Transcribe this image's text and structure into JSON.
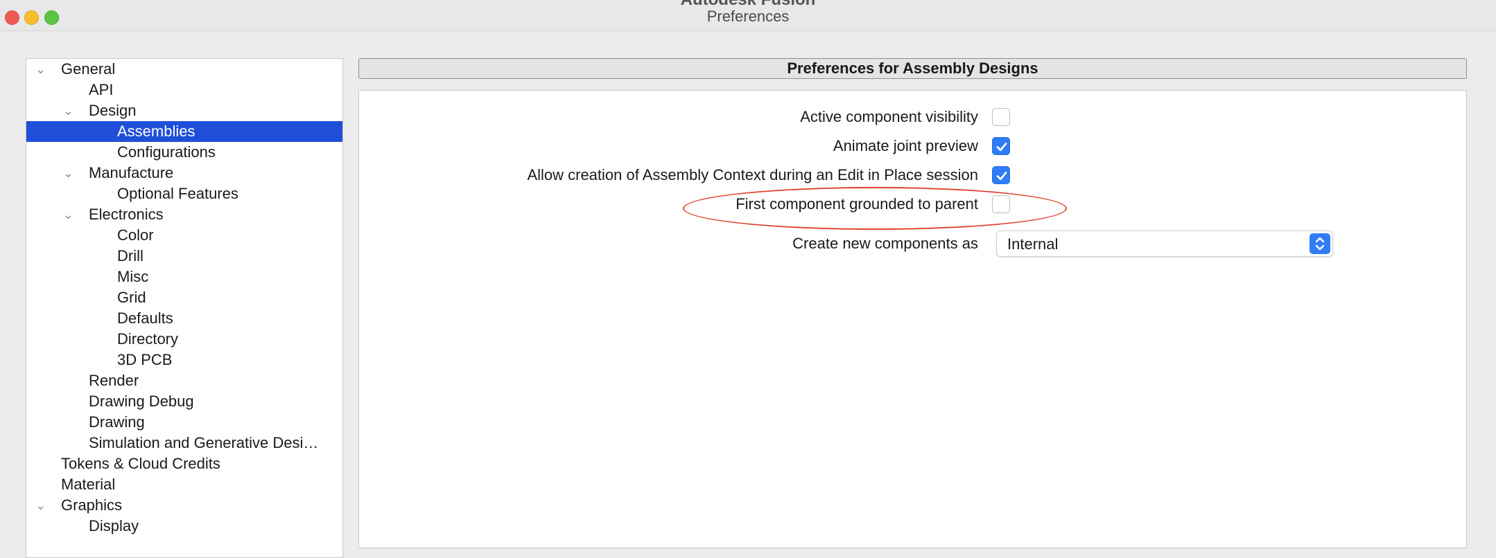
{
  "window": {
    "app_title": "Autodesk Fusion",
    "title": "Preferences"
  },
  "tree": {
    "items": [
      {
        "label": "General",
        "expanded": true
      },
      {
        "label": "API"
      },
      {
        "label": "Design",
        "expanded": true
      },
      {
        "label": "Assemblies",
        "selected": true
      },
      {
        "label": "Configurations"
      },
      {
        "label": "Manufacture",
        "expanded": true
      },
      {
        "label": "Optional Features"
      },
      {
        "label": "Electronics",
        "expanded": true
      },
      {
        "label": "Color"
      },
      {
        "label": "Drill"
      },
      {
        "label": "Misc"
      },
      {
        "label": "Grid"
      },
      {
        "label": "Defaults"
      },
      {
        "label": "Directory"
      },
      {
        "label": "3D PCB"
      },
      {
        "label": "Render"
      },
      {
        "label": "Drawing Debug"
      },
      {
        "label": "Drawing"
      },
      {
        "label": "Simulation and Generative Desi…"
      },
      {
        "label": "Tokens & Cloud Credits"
      },
      {
        "label": "Material"
      },
      {
        "label": "Graphics",
        "expanded": true
      },
      {
        "label": "Display"
      }
    ]
  },
  "panel": {
    "header": "Preferences for Assembly Designs",
    "options": [
      {
        "label": "Active component visibility",
        "checked": false
      },
      {
        "label": "Animate joint preview",
        "checked": true
      },
      {
        "label": "Allow creation of Assembly Context during an Edit in Place session",
        "checked": true
      },
      {
        "label": "First component grounded to parent",
        "checked": false
      }
    ],
    "create_new": {
      "label": "Create new components as",
      "value": "Internal"
    }
  },
  "colors": {
    "selection": "#1f4fd9",
    "checkbox_checked": "#2f7cf6",
    "annotation": "#e0422b"
  }
}
